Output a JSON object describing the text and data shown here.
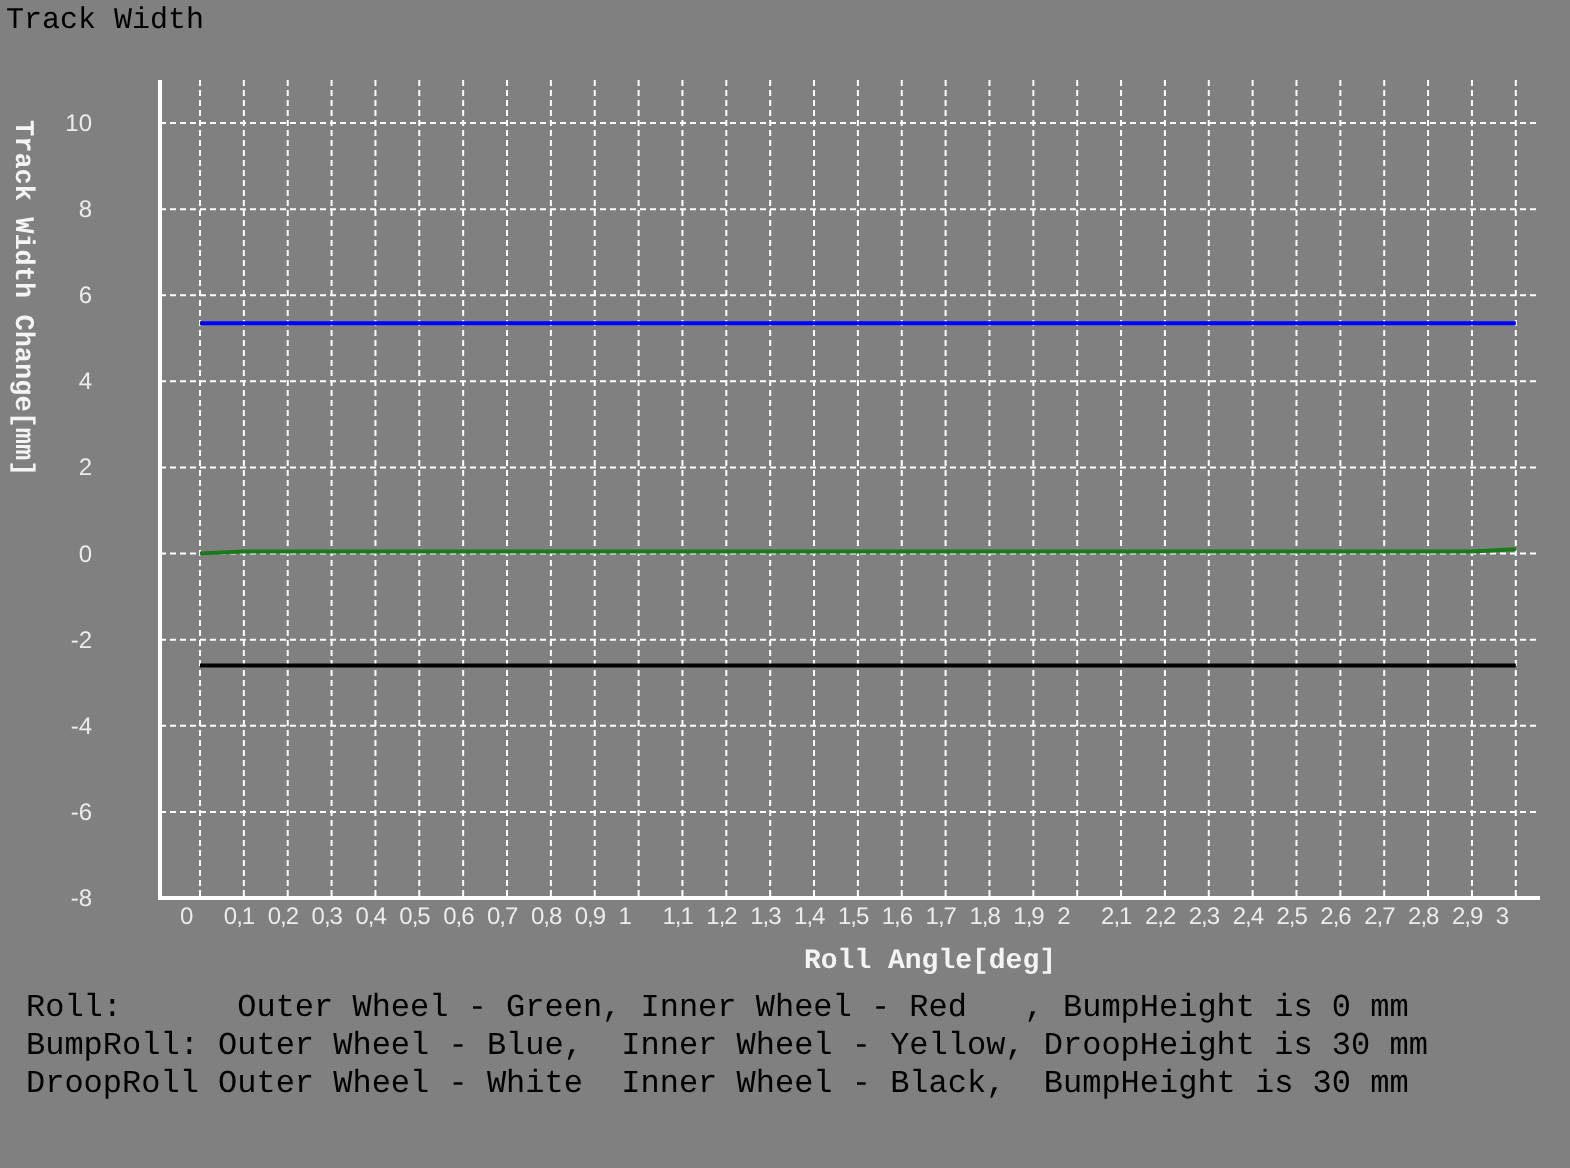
{
  "title": "Track Width",
  "chart": {
    "chart_data": {
      "type": "line",
      "xlabel": "Roll Angle[deg]",
      "ylabel": "Track Width Change[mm]",
      "categories": [
        "0",
        "0,1",
        "0,2",
        "0,3",
        "0,4",
        "0,5",
        "0,6",
        "0,7",
        "0,8",
        "0,9",
        "1",
        "1,1",
        "1,2",
        "1,3",
        "1,4",
        "1,5",
        "1,6",
        "1,7",
        "1,8",
        "1,9",
        "2",
        "2,1",
        "2,2",
        "2,3",
        "2,4",
        "2,5",
        "2,6",
        "2,7",
        "2,8",
        "2,9",
        "3"
      ],
      "ylim": [
        -8,
        11
      ],
      "grid": true,
      "yticks": [
        -8,
        -6,
        -4,
        -2,
        0,
        2,
        4,
        6,
        8,
        10
      ],
      "series": [
        {
          "color": "#0000ff",
          "values": [
            5.35,
            5.35,
            5.35,
            5.35,
            5.35,
            5.35,
            5.35,
            5.35,
            5.35,
            5.35,
            5.35,
            5.35,
            5.35,
            5.35,
            5.35,
            5.35,
            5.35,
            5.35,
            5.35,
            5.35,
            5.35,
            5.35,
            5.35,
            5.35,
            5.35,
            5.35,
            5.35,
            5.35,
            5.35,
            5.35,
            5.35
          ]
        },
        {
          "color": "#1a7a1a",
          "values": [
            0,
            0.05,
            0.05,
            0.05,
            0.05,
            0.05,
            0.05,
            0.05,
            0.05,
            0.05,
            0.05,
            0.05,
            0.05,
            0.05,
            0.05,
            0.05,
            0.05,
            0.05,
            0.05,
            0.05,
            0.05,
            0.05,
            0.05,
            0.05,
            0.05,
            0.05,
            0.05,
            0.05,
            0.05,
            0.05,
            0.1
          ]
        },
        {
          "color": "#000000",
          "values": [
            -2.6,
            -2.6,
            -2.6,
            -2.6,
            -2.6,
            -2.6,
            -2.6,
            -2.6,
            -2.6,
            -2.6,
            -2.6,
            -2.6,
            -2.6,
            -2.6,
            -2.6,
            -2.6,
            -2.6,
            -2.6,
            -2.6,
            -2.6,
            -2.6,
            -2.6,
            -2.6,
            -2.6,
            -2.6,
            -2.6,
            -2.6,
            -2.6,
            -2.6,
            -2.6,
            -2.6
          ]
        }
      ]
    }
  },
  "legend": [
    "Roll:      Outer Wheel - Green, Inner Wheel - Red   , BumpHeight is 0 mm",
    "BumpRoll: Outer Wheel - Blue,  Inner Wheel - Yellow, DroopHeight is 30 mm",
    "DroopRoll Outer Wheel - White  Inner Wheel - Black,  BumpHeight is 30 mm"
  ]
}
